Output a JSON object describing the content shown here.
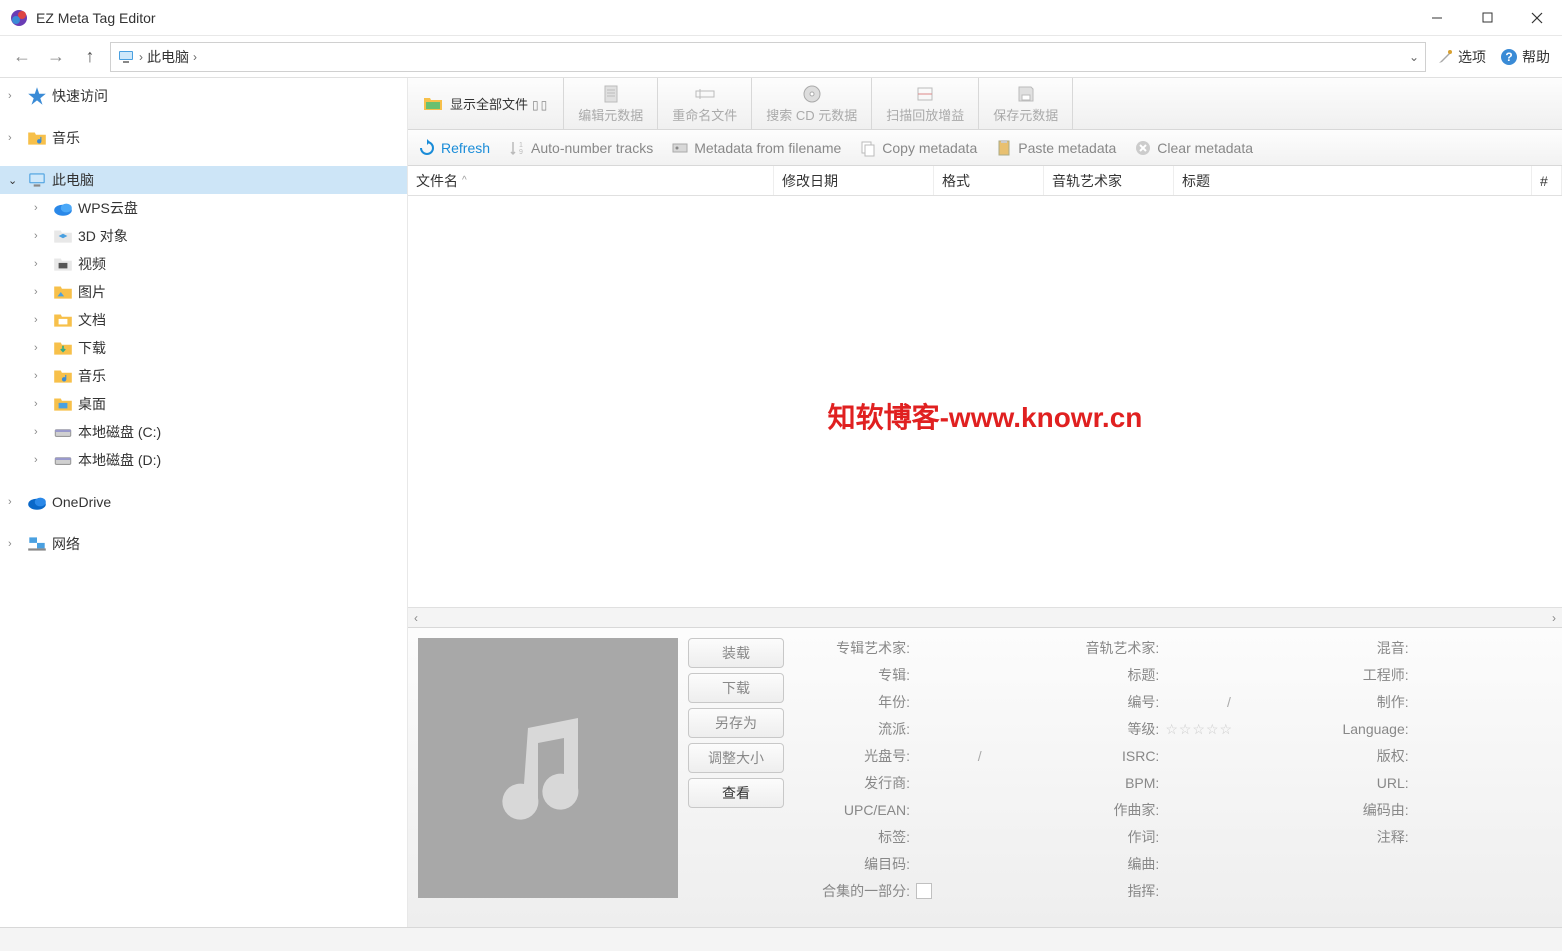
{
  "window": {
    "title": "EZ Meta Tag Editor"
  },
  "nav": {
    "breadcrumb": "此电脑",
    "options": "选项",
    "help": "帮助"
  },
  "tree": {
    "quick": "快速访问",
    "music": "音乐",
    "pc": "此电脑",
    "children": [
      {
        "label": "WPS云盘",
        "icon": "cloud"
      },
      {
        "label": "3D 对象",
        "icon": "3d"
      },
      {
        "label": "视频",
        "icon": "video"
      },
      {
        "label": "图片",
        "icon": "pic"
      },
      {
        "label": "文档",
        "icon": "doc"
      },
      {
        "label": "下载",
        "icon": "dl"
      },
      {
        "label": "音乐",
        "icon": "music"
      },
      {
        "label": "桌面",
        "icon": "desk"
      },
      {
        "label": "本地磁盘 (C:)",
        "icon": "disk"
      },
      {
        "label": "本地磁盘 (D:)",
        "icon": "disk"
      }
    ],
    "onedrive": "OneDrive",
    "network": "网络"
  },
  "toolbar": {
    "show_all": "显示全部文件",
    "edit_meta": "编辑元数据",
    "rename": "重命名文件",
    "search_cd": "搜索 CD 元数据",
    "scan_gain": "扫描回放增益",
    "save_meta": "保存元数据"
  },
  "actions": {
    "refresh": "Refresh",
    "autonum": "Auto-number tracks",
    "meta_fn": "Metadata from filename",
    "copy_meta": "Copy metadata",
    "paste_meta": "Paste metadata",
    "clear_meta": "Clear metadata"
  },
  "columns": {
    "filename": "文件名",
    "moddate": "修改日期",
    "format": "格式",
    "artist": "音轨艺术家",
    "title": "标题",
    "num": "#"
  },
  "watermark": "知软博客-www.knowr.cn",
  "artbtns": {
    "load": "装载",
    "download": "下载",
    "saveas": "另存为",
    "resize": "调整大小",
    "view": "查看"
  },
  "meta": {
    "album_artist": "专辑艺术家:",
    "album": "专辑:",
    "year": "年份:",
    "genre": "流派:",
    "disc": "光盘号:",
    "publisher": "发行商:",
    "upcean": "UPC/EAN:",
    "tags": "标签:",
    "catalog": "编目码:",
    "compilation": "合集的一部分:",
    "track_artist": "音轨艺术家:",
    "title": "标题:",
    "track_no": "编号:",
    "rating": "等级:",
    "isrc": "ISRC:",
    "bpm": "BPM:",
    "composer": "作曲家:",
    "lyricist": "作词:",
    "arranger": "编曲:",
    "conductor": "指挥:",
    "mix": "混音:",
    "engineer": "工程师:",
    "production": "制作:",
    "language": "Language:",
    "copyright": "版权:",
    "url": "URL:",
    "encodedby": "编码由:",
    "comment": "注释:",
    "slash": "/"
  }
}
